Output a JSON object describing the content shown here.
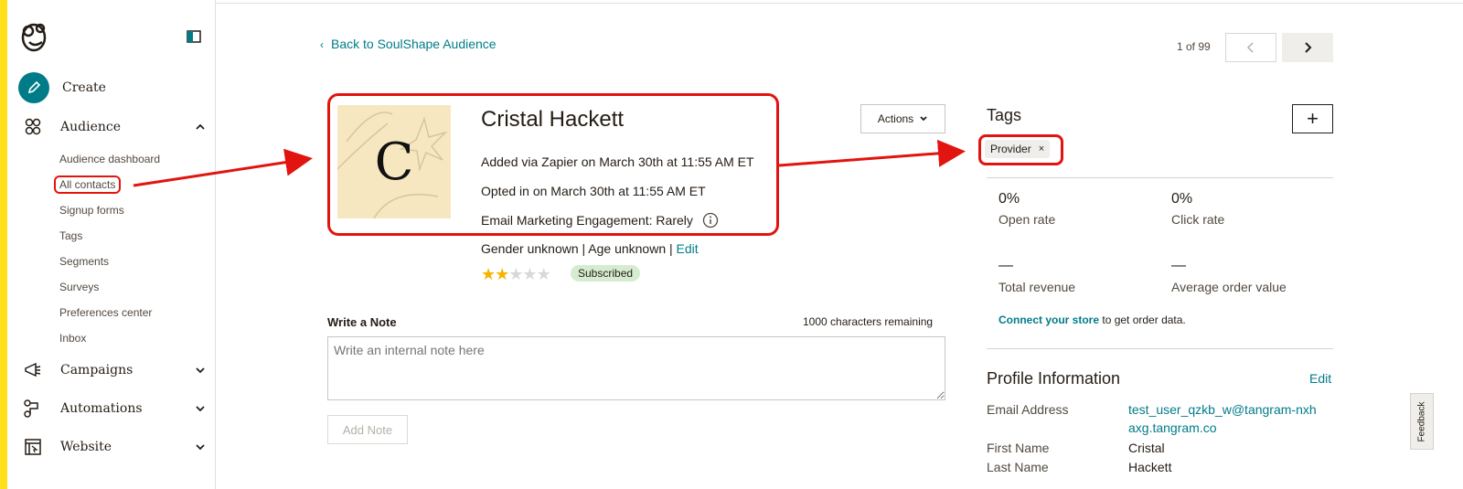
{
  "sidebar": {
    "create_label": "Create",
    "audience_label": "Audience",
    "audience_items": [
      "Audience dashboard",
      "All contacts",
      "Signup forms",
      "Tags",
      "Segments",
      "Surveys",
      "Preferences center",
      "Inbox"
    ],
    "campaigns_label": "Campaigns",
    "automations_label": "Automations",
    "website_label": "Website"
  },
  "header": {
    "back_link": "Back to SoulShape Audience",
    "pager_text": "1 of 99"
  },
  "contact": {
    "avatar_letter": "C",
    "name": "Cristal Hackett",
    "added": "Added via Zapier on March 30th at 11:55 AM ET",
    "opted_in": "Opted in on March 30th at 11:55 AM ET",
    "engagement": "Email Marketing Engagement: Rarely",
    "demographics": "Gender unknown | Age unknown |",
    "edit_label": "Edit",
    "rating": 2,
    "rating_max": 5,
    "status": "Subscribed",
    "actions_label": "Actions"
  },
  "note": {
    "label": "Write a Note",
    "remaining": "1000 characters remaining",
    "placeholder": "Write an internal note here",
    "add_label": "Add Note"
  },
  "tags": {
    "title": "Tags",
    "add_symbol": "+",
    "items": [
      {
        "label": "Provider",
        "remove": "×"
      }
    ]
  },
  "stats": {
    "open_rate_value": "0%",
    "open_rate_label": "Open rate",
    "click_rate_value": "0%",
    "click_rate_label": "Click rate",
    "total_revenue_value": "—",
    "total_revenue_label": "Total revenue",
    "aov_value": "—",
    "aov_label": "Average order value",
    "connect_link": "Connect your store",
    "connect_rest": "to get order data."
  },
  "profile_info": {
    "title": "Profile Information",
    "edit_label": "Edit",
    "email_label": "Email Address",
    "email_value": "test_user_qzkb_w@tangram-nxhaxg.tangram.co",
    "first_name_label": "First Name",
    "first_name_value": "Cristal",
    "last_name_label": "Last Name",
    "last_name_value": "Hackett"
  },
  "feedback_label": "Feedback",
  "colors": {
    "accent": "#007c89",
    "annotation_red": "#e2140f",
    "brand_yellow": "#ffe01b",
    "star": "#f5b400"
  }
}
